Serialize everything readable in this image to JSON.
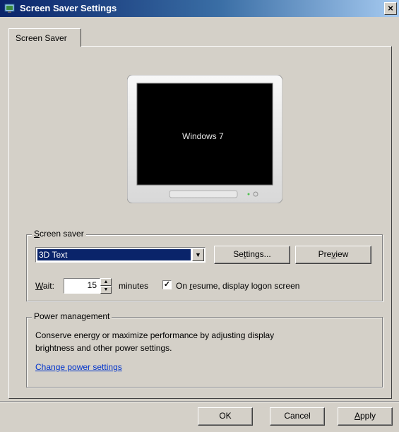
{
  "window": {
    "title": "Screen Saver Settings",
    "close_label": "×"
  },
  "tabs": [
    {
      "label": "Screen Saver"
    }
  ],
  "preview_monitor": {
    "text": "Windows 7"
  },
  "screen_saver_group": {
    "legend_prefix": "",
    "legend_underlined": "S",
    "legend_rest": "creen saver",
    "selected_value": "3D Text",
    "dropdown_glyph": "▼",
    "settings_button": {
      "before": "Se",
      "underlined": "t",
      "after": "tings..."
    },
    "preview_button": {
      "before": "Pre",
      "underlined": "v",
      "after": "iew"
    },
    "wait_label": {
      "underlined": "W",
      "after": "ait:"
    },
    "wait_value": "15",
    "minutes_label": "minutes",
    "resume_checked": true,
    "resume_label": {
      "before": "On ",
      "underlined": "r",
      "after": "esume, display logon screen"
    }
  },
  "power_group": {
    "legend": "Power management",
    "description_line1": "Conserve energy or maximize performance by adjusting display",
    "description_line2": "brightness and other power settings.",
    "link": "Change power settings"
  },
  "footer": {
    "ok": "OK",
    "cancel": "Cancel",
    "apply": {
      "underlined": "A",
      "after": "pply"
    }
  }
}
